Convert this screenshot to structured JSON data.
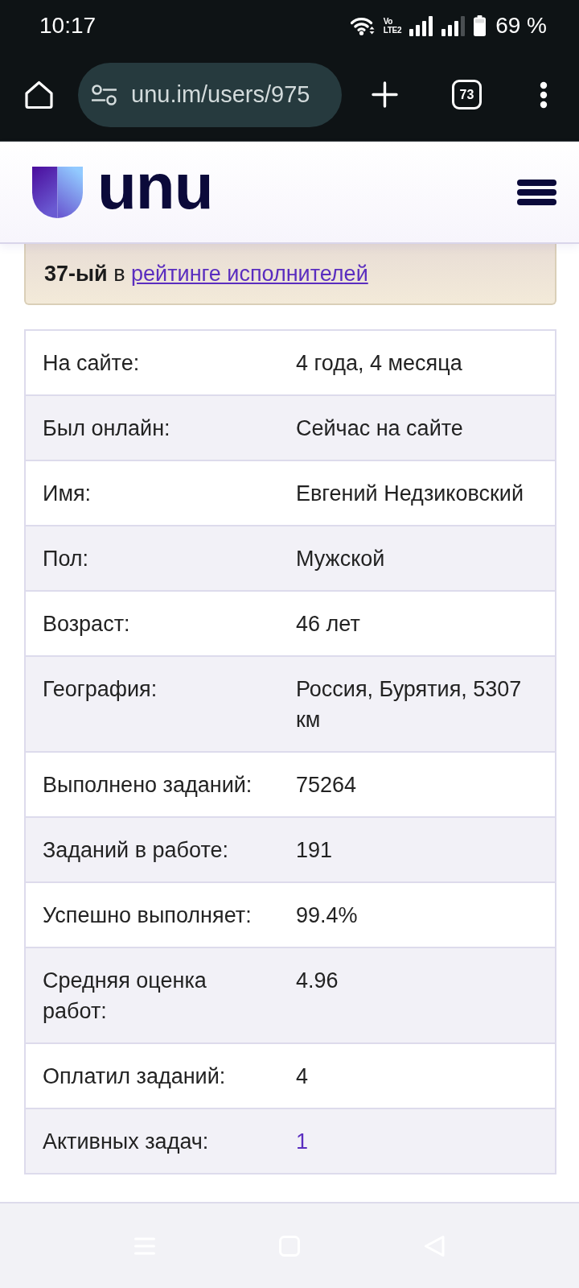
{
  "status_bar": {
    "time": "10:17",
    "network_label": [
      "Vo",
      "LTE2"
    ],
    "battery": "69 %"
  },
  "browser_toolbar": {
    "url": "unu.im/users/975",
    "tab_count": "73"
  },
  "site_header": {
    "logo_text": "unu"
  },
  "rating_notice": {
    "text": "**37-ый** в",
    "link": "рейтинге исполнителей"
  },
  "profile_table": {
    "rows": [
      {
        "label": "На сайте:",
        "value": "4 года, 4 месяца",
        "kind": "text"
      },
      {
        "label": "Был онлайн:",
        "value": "Сейчас на сайте",
        "kind": "text"
      },
      {
        "label": "Имя:",
        "value": "Евгений Недзиковский",
        "kind": "text"
      },
      {
        "label": "Пол:",
        "value": "Мужской",
        "kind": "text"
      },
      {
        "label": "Возраст:",
        "value": "46 лет",
        "kind": "text"
      },
      {
        "label": "География:",
        "value": "Россия, Бурятия, 5307 км",
        "kind": "text"
      },
      {
        "label": "Выполнено заданий:",
        "value": "75264",
        "kind": "text"
      },
      {
        "label": "Заданий в работе:",
        "value": "191",
        "kind": "text"
      },
      {
        "label": "Успешно выполняет:",
        "value": "99.4%",
        "kind": "text"
      },
      {
        "label": "Средняя оценка работ:",
        "value": "4.96",
        "kind": "text"
      },
      {
        "label": "Оплатил заданий:",
        "value": "4",
        "kind": "text"
      },
      {
        "label": "Активных задач:",
        "value": "1",
        "kind": "link"
      }
    ]
  }
}
